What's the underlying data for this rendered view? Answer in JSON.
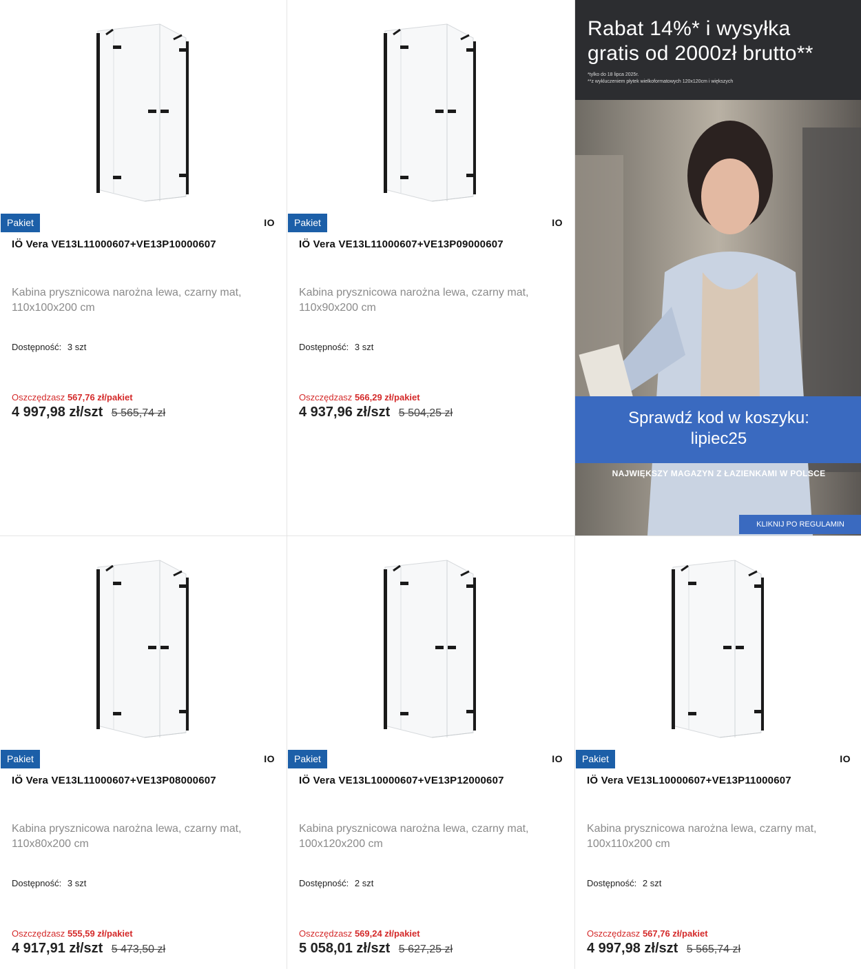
{
  "colors": {
    "badge": "#1c5fa8",
    "savings": "#d42a2a",
    "promo_blue": "#3a6ac0"
  },
  "products": [
    {
      "badge": "Pakiet",
      "brand": "IO",
      "title": "IÖ Vera VE13L11000607+VE13P10000607",
      "desc_line1": "Kabina prysznicowa narożna lewa, czarny mat,",
      "desc_line2": "110x100x200 cm",
      "avail_label": "Dostępność:",
      "avail_value": "3 szt",
      "save_label": "Oszczędzasz",
      "save_value": "567,76 zł/pakiet",
      "price": "4 997,98 zł/szt",
      "old_price": "5 565,74 zł"
    },
    {
      "badge": "Pakiet",
      "brand": "IO",
      "title": "IÖ Vera VE13L11000607+VE13P09000607",
      "desc_line1": "Kabina prysznicowa narożna lewa, czarny mat,",
      "desc_line2": "110x90x200 cm",
      "avail_label": "Dostępność:",
      "avail_value": "3 szt",
      "save_label": "Oszczędzasz",
      "save_value": "566,29 zł/pakiet",
      "price": "4 937,96 zł/szt",
      "old_price": "5 504,25 zł"
    },
    {
      "badge": "Pakiet",
      "brand": "IO",
      "title": "IÖ Vera VE13L11000607+VE13P08000607",
      "desc_line1": "Kabina prysznicowa narożna lewa, czarny mat,",
      "desc_line2": "110x80x200 cm",
      "avail_label": "Dostępność:",
      "avail_value": "3 szt",
      "save_label": "Oszczędzasz",
      "save_value": "555,59 zł/pakiet",
      "price": "4 917,91 zł/szt",
      "old_price": "5 473,50 zł"
    },
    {
      "badge": "Pakiet",
      "brand": "IO",
      "title": "IÖ Vera VE13L10000607+VE13P12000607",
      "desc_line1": "Kabina prysznicowa narożna lewa, czarny mat,",
      "desc_line2": "100x120x200 cm",
      "avail_label": "Dostępność:",
      "avail_value": "2 szt",
      "save_label": "Oszczędzasz",
      "save_value": "569,24 zł/pakiet",
      "price": "5 058,01 zł/szt",
      "old_price": "5 627,25 zł"
    },
    {
      "badge": "Pakiet",
      "brand": "IO",
      "title": "IÖ Vera VE13L10000607+VE13P11000607",
      "desc_line1": "Kabina prysznicowa narożna lewa, czarny mat,",
      "desc_line2": "100x110x200 cm",
      "avail_label": "Dostępność:",
      "avail_value": "2 szt",
      "save_label": "Oszczędzasz",
      "save_value": "567,76 zł/pakiet",
      "price": "4 997,98 zł/szt",
      "old_price": "5 565,74 zł"
    }
  ],
  "promo": {
    "headline_line1": "Rabat 14%* i wysyłka",
    "headline_line2": "gratis od 2000zł brutto**",
    "fine_line1": "*tylko do 18 lipca 2025r.",
    "fine_line2": "**z wykluczeniem płytek wielkoformatowych 120x120cm i większych",
    "code_line1": "Sprawdź kod w koszyku:",
    "code_line2": "lipiec25",
    "tagline": "NAJWIĘKSZY MAGAZYN Z ŁAZIENKAMI W POLSCE",
    "button": "KLIKNIJ PO REGULAMIN"
  }
}
